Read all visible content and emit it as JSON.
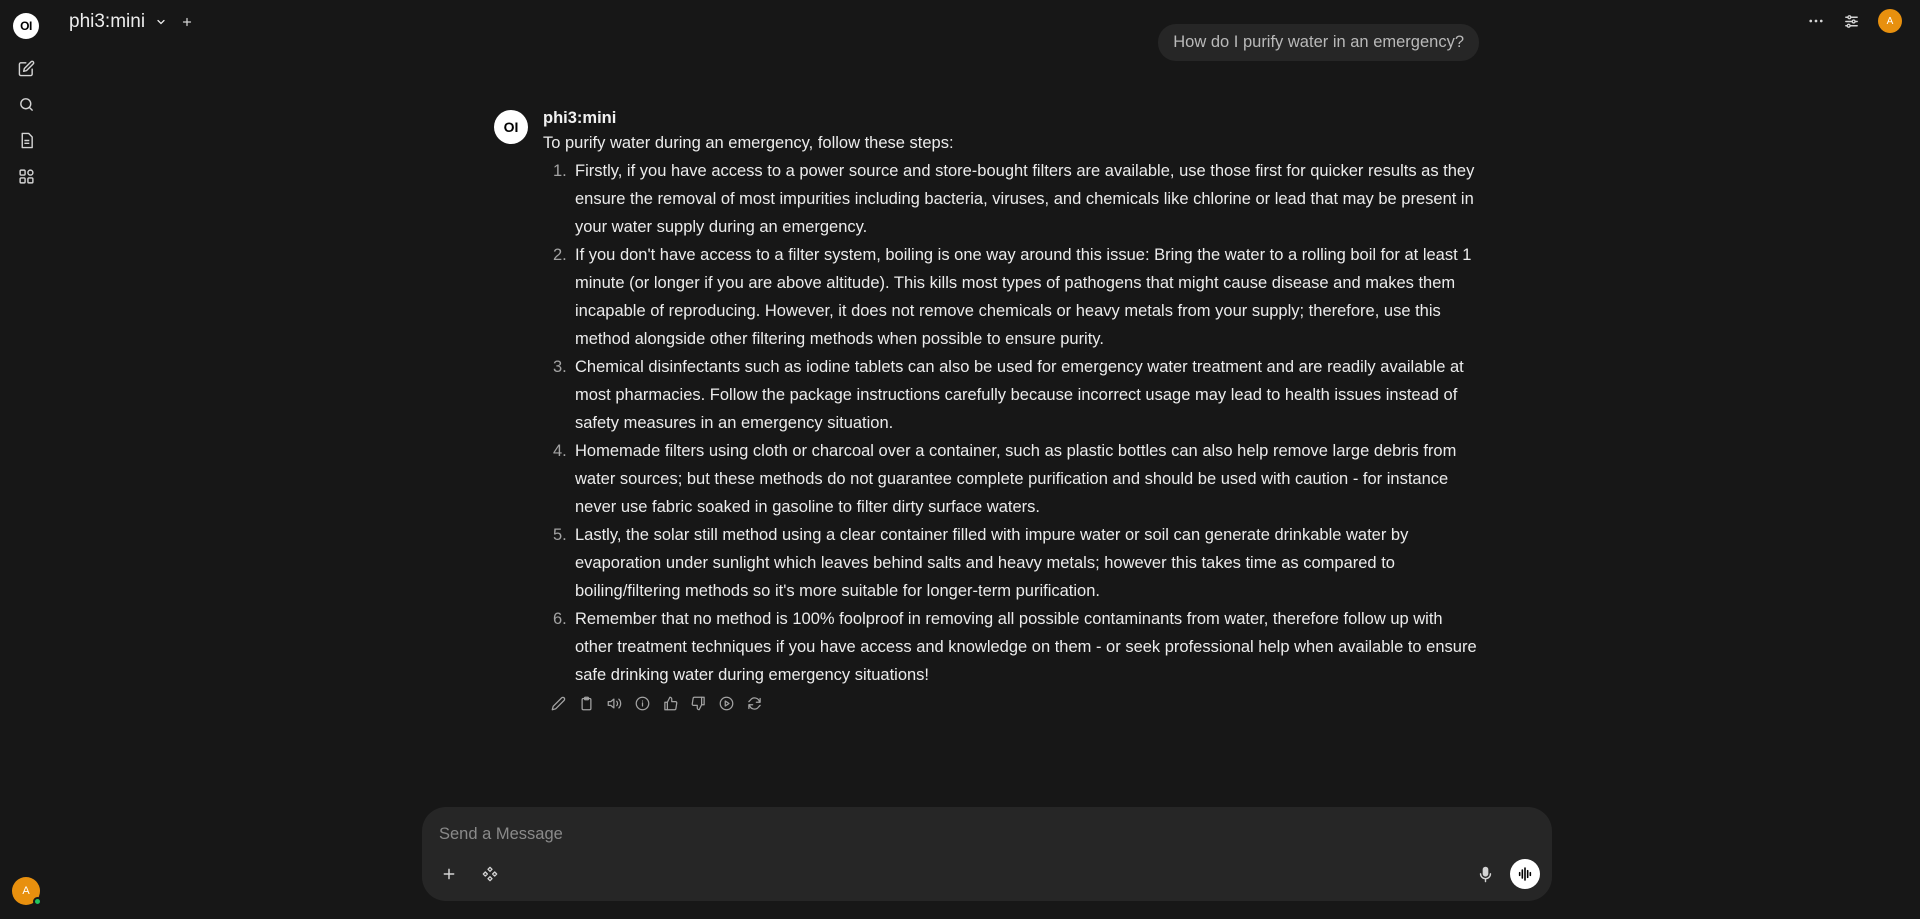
{
  "rail": {
    "logo_text": "OI",
    "user_initial": "A",
    "icons": [
      "new-chat-icon",
      "search-icon",
      "notes-icon",
      "workspace-icon"
    ]
  },
  "topbar": {
    "model_name": "phi3:mini",
    "avatar_initial": "A"
  },
  "chat": {
    "user_message": "How do I purify water in an emergency?",
    "assistant": {
      "avatar_text": "OI",
      "name": "phi3:mini",
      "intro": "To purify water during an emergency, follow these steps:",
      "steps": [
        {
          "n": "1.",
          "text": "Firstly, if you have access to a power source and store-bought filters are available, use those first for quicker results as they ensure the removal of most impurities including bacteria, viruses, and chemicals like chlorine or lead that may be present in your water supply during an emergency."
        },
        {
          "n": "2.",
          "text": "If you don't have access to a filter system, boiling is one way around this issue: Bring the water to a rolling boil for at least 1 minute (or longer if you are above altitude). This kills most types of pathogens that might cause disease and makes them incapable of reproducing. However, it does not remove chemicals or heavy metals from your supply; therefore, use this method alongside other filtering methods when possible to ensure purity."
        },
        {
          "n": "3.",
          "text": "Chemical disinfectants such as iodine tablets can also be used for emergency water treatment and are readily available at most pharmacies. Follow the package instructions carefully because incorrect usage may lead to health issues instead of safety measures in an emergency situation."
        },
        {
          "n": "4.",
          "text": "Homemade filters using cloth or charcoal over a container, such as plastic bottles can also help remove large debris from water sources; but these methods do not guarantee complete purification and should be used with caution - for instance never use fabric soaked in gasoline to filter dirty surface waters."
        },
        {
          "n": "5.",
          "text": "Lastly, the solar still method using a clear container filled with impure water or soil can generate drinkable water by evaporation under sunlight which leaves behind salts and heavy metals; however this takes time as compared to boiling/filtering methods so it's more suitable for longer-term purification."
        },
        {
          "n": "6.",
          "text": "Remember that no method is 100% foolproof in removing all possible contaminants from water, therefore follow up with other treatment techniques if you have access and knowledge on them - or seek professional help when available to ensure safe drinking water during emergency situations!"
        }
      ],
      "action_icons": [
        "edit-icon",
        "copy-icon",
        "read-aloud-icon",
        "info-icon",
        "thumbs-up-icon",
        "thumbs-down-icon",
        "continue-icon",
        "regenerate-icon"
      ]
    }
  },
  "composer": {
    "placeholder": "Send a Message"
  }
}
